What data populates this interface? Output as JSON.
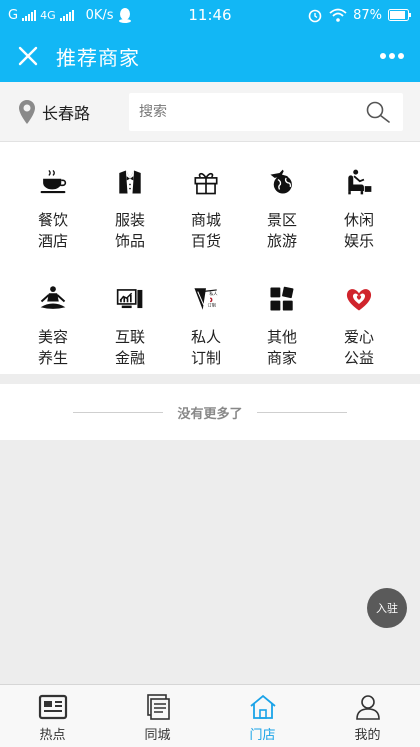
{
  "status_bar": {
    "carrier": "G",
    "network": "4G",
    "speed": "0K/s",
    "time": "11:46",
    "battery": "87%"
  },
  "header": {
    "title": "推荐商家"
  },
  "location": {
    "label": "长春路"
  },
  "search": {
    "placeholder": "搜索"
  },
  "categories": [
    {
      "line1": "餐饮",
      "line2": "酒店",
      "icon": "coffee-cup-icon"
    },
    {
      "line1": "服装",
      "line2": "饰品",
      "icon": "tuxedo-icon"
    },
    {
      "line1": "商城",
      "line2": "百货",
      "icon": "gift-box-icon"
    },
    {
      "line1": "景区",
      "line2": "旅游",
      "icon": "globe-plane-icon"
    },
    {
      "line1": "休闲",
      "line2": "娱乐",
      "icon": "armchair-icon"
    },
    {
      "line1": "美容",
      "line2": "养生",
      "icon": "meditation-icon"
    },
    {
      "line1": "互联",
      "line2": "金融",
      "icon": "computer-chart-icon"
    },
    {
      "line1": "私人",
      "line2": "订制",
      "icon": "custom-logo-icon",
      "logo_text": "私人订制"
    },
    {
      "line1": "其他",
      "line2": "商家",
      "icon": "grid-squares-icon"
    },
    {
      "line1": "爱心",
      "line2": "公益",
      "icon": "heart-charity-icon"
    }
  ],
  "list_end": {
    "text": "没有更多了"
  },
  "fab": {
    "label": "入驻"
  },
  "tabbar": {
    "items": [
      {
        "label": "热点",
        "icon": "news-icon",
        "active": false
      },
      {
        "label": "同城",
        "icon": "documents-icon",
        "active": false
      },
      {
        "label": "门店",
        "icon": "home-icon",
        "active": true
      },
      {
        "label": "我的",
        "icon": "user-icon",
        "active": false
      }
    ]
  },
  "colors": {
    "brand": "#12b7f5",
    "active_tab": "#1aa3e8",
    "heart": "#d0242c"
  }
}
